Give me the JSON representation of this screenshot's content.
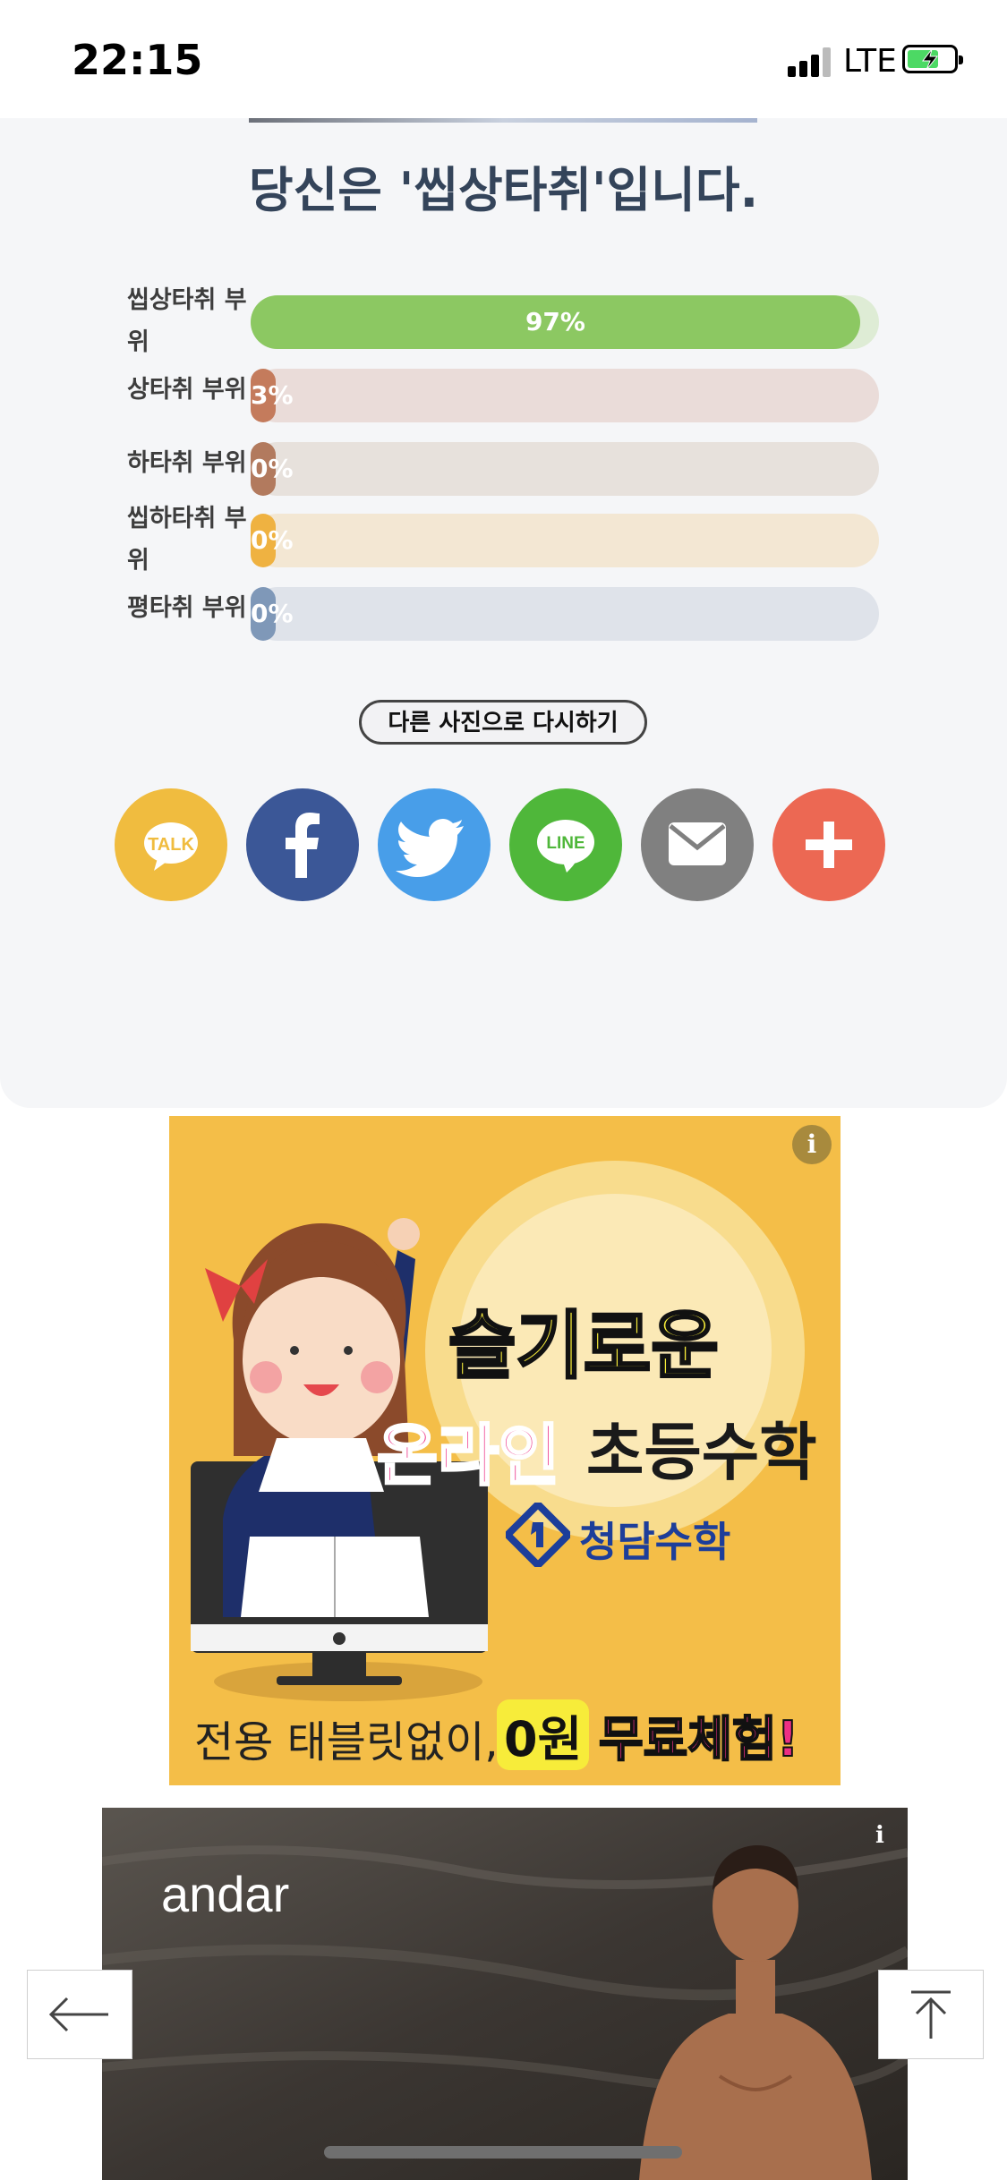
{
  "status_bar": {
    "time": "22:15",
    "network": "LTE"
  },
  "result": {
    "title": "당신은 '씹상타취'입니다.",
    "rows": [
      {
        "label": "씹상타취 부위",
        "percent": 97,
        "percent_text": "97%",
        "bar_color": "#8cc862",
        "track_color": "#deecd5"
      },
      {
        "label": "상타취 부위",
        "percent": 3,
        "percent_text": "3%",
        "bar_color": "#c47b5c",
        "track_color": "#eadcd9"
      },
      {
        "label": "하타취 부위",
        "percent": 0,
        "percent_text": "0%",
        "bar_color": "#b27a5e",
        "track_color": "#e7e1dc"
      },
      {
        "label": "씹하타취 부위",
        "percent": 0,
        "percent_text": "0%",
        "bar_color": "#efb241",
        "track_color": "#f3e7d3"
      },
      {
        "label": "평타취 부위",
        "percent": 0,
        "percent_text": "0%",
        "bar_color": "#7f98b8",
        "track_color": "#dfe3ea"
      }
    ],
    "retry_button": "다른 사진으로 다시하기"
  },
  "share": {
    "buttons": [
      {
        "name": "kakaotalk",
        "icon": "kakaotalk-talk-icon",
        "icon_text": "TALK",
        "color": "#f0bc3f"
      },
      {
        "name": "facebook",
        "icon": "facebook-icon",
        "color": "#3b5797"
      },
      {
        "name": "twitter",
        "icon": "twitter-bird-icon",
        "color": "#489ee9"
      },
      {
        "name": "line",
        "icon": "line-icon",
        "icon_text": "LINE",
        "color": "#4fb73a"
      },
      {
        "name": "email",
        "icon": "envelope-icon",
        "color": "#808080"
      },
      {
        "name": "more",
        "icon": "plus-icon",
        "color": "#ec6853"
      }
    ]
  },
  "ads": {
    "ad1": {
      "headline": "슬기로운",
      "line2_pink": "온라인",
      "line2_black": "초등수학",
      "brand": "청담수학",
      "footer_text": "전용 태블릿없이,",
      "footer_badge": "0원",
      "footer_highlight": "무료체험!",
      "info_icon": "i"
    },
    "ad2": {
      "brand": "andar",
      "info_icon": "i"
    }
  },
  "nav": {
    "back_icon": "arrow-left-icon",
    "top_icon": "arrow-up-to-top-icon"
  }
}
